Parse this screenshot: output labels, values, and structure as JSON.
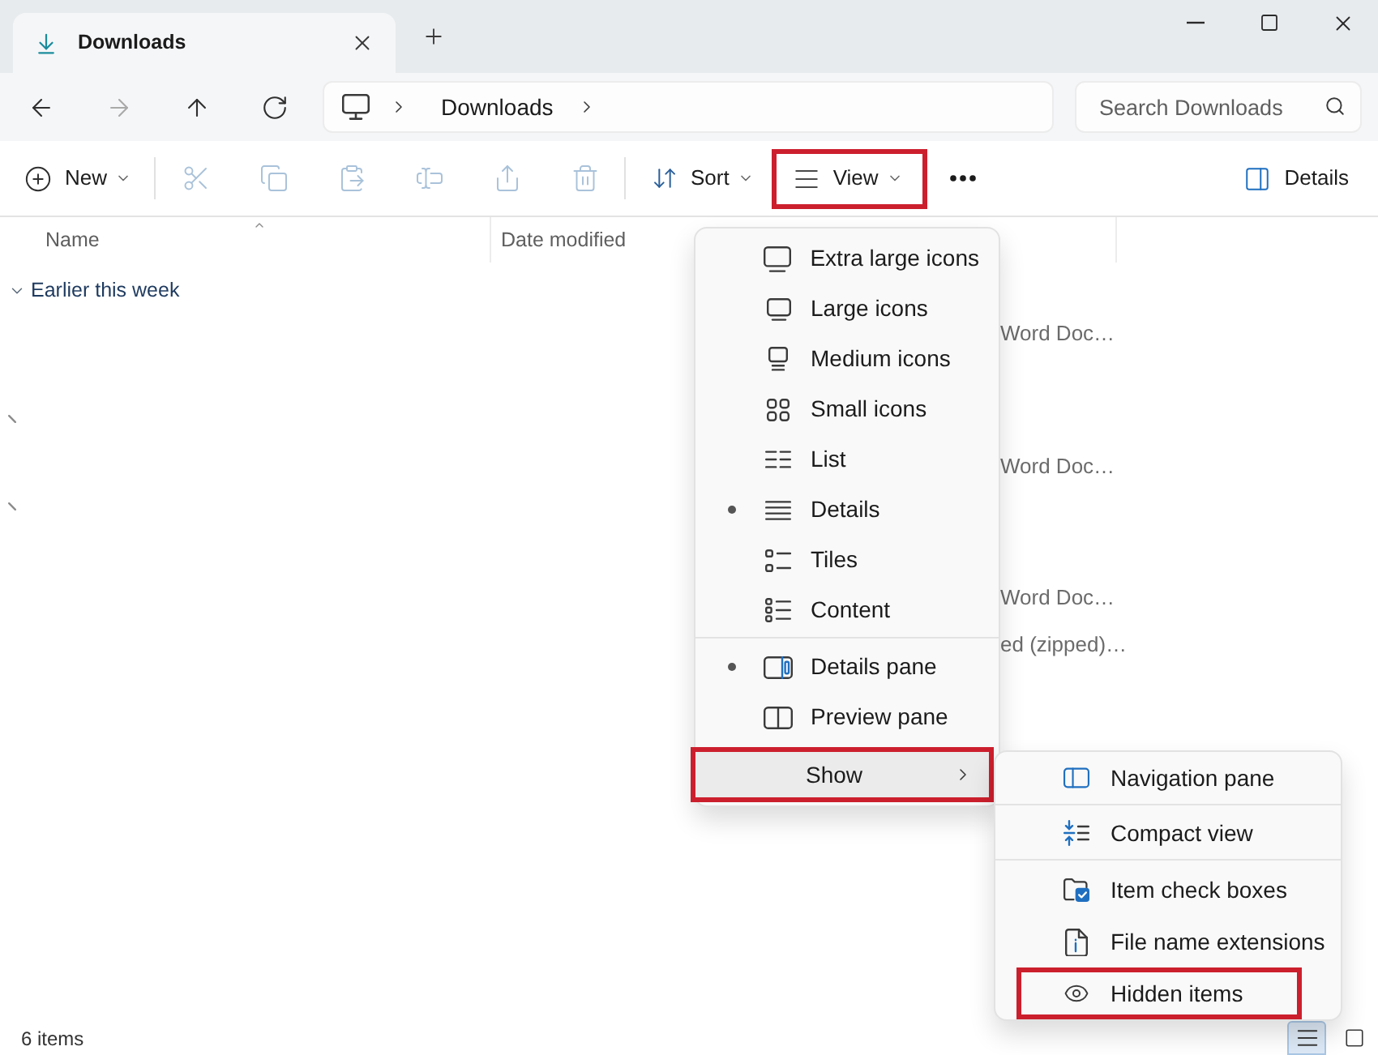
{
  "title_bar": {
    "tabs": [
      {
        "title": "Downloads",
        "selected": true
      }
    ]
  },
  "nav": {
    "buttons": [
      {
        "disabled": false
      },
      {
        "disabled": true
      },
      {
        "disabled": false
      },
      {
        "disabled": false
      }
    ],
    "path": [
      "Downloads"
    ],
    "search": {
      "placeholder": "Search Downloads"
    }
  },
  "toolbar": {
    "new": {
      "label": "New"
    },
    "actions": [
      {
        "disabled": true
      },
      {
        "disabled": true
      },
      {
        "disabled": true
      },
      {
        "disabled": true
      },
      {
        "disabled": true
      },
      {
        "disabled": true
      }
    ],
    "sort": {
      "label": "Sort"
    },
    "view": {
      "label": "View",
      "highlighted": true
    },
    "details": {
      "label": "Details"
    }
  },
  "columns": [
    {
      "label": "Name",
      "sorted": true
    },
    {
      "label": "Date modified",
      "sorted": false
    }
  ],
  "group": {
    "label": "Earlier this week",
    "expanded": true
  },
  "rows": [
    {
      "kind": "file",
      "type": "Word Doc…"
    },
    {
      "kind": "marker"
    },
    {
      "kind": "file",
      "type": "Word Doc…"
    },
    {
      "kind": "marker"
    },
    {
      "kind": "file",
      "type": "Word Doc…"
    },
    {
      "kind": "file",
      "type": "ed (zipped)…"
    }
  ],
  "view_menu": {
    "layouts": [
      {
        "label": "Extra large icons",
        "selected": false
      },
      {
        "label": "Large icons",
        "selected": false
      },
      {
        "label": "Medium icons",
        "selected": false
      },
      {
        "label": "Small icons",
        "selected": false
      },
      {
        "label": "List",
        "selected": false
      },
      {
        "label": "Details",
        "selected": true
      },
      {
        "label": "Tiles",
        "selected": false
      },
      {
        "label": "Content",
        "selected": false
      }
    ],
    "panes": [
      {
        "label": "Details pane",
        "checked": true
      },
      {
        "label": "Preview pane",
        "checked": false
      }
    ],
    "show": {
      "label": "Show",
      "expanded": true,
      "highlighted": true
    }
  },
  "show_menu": {
    "sections": [
      [
        {
          "label": "Navigation pane",
          "highlighted": false
        }
      ],
      [
        {
          "label": "Compact view",
          "highlighted": false
        }
      ],
      [
        {
          "label": "Item check boxes",
          "highlighted": false
        },
        {
          "label": "File name extensions",
          "highlighted": false
        },
        {
          "label": "Hidden items",
          "highlighted": true
        }
      ]
    ]
  },
  "status_bar": {
    "count": "6 items",
    "view_buttons": [
      {
        "selected": true
      },
      {
        "selected": false
      }
    ]
  }
}
